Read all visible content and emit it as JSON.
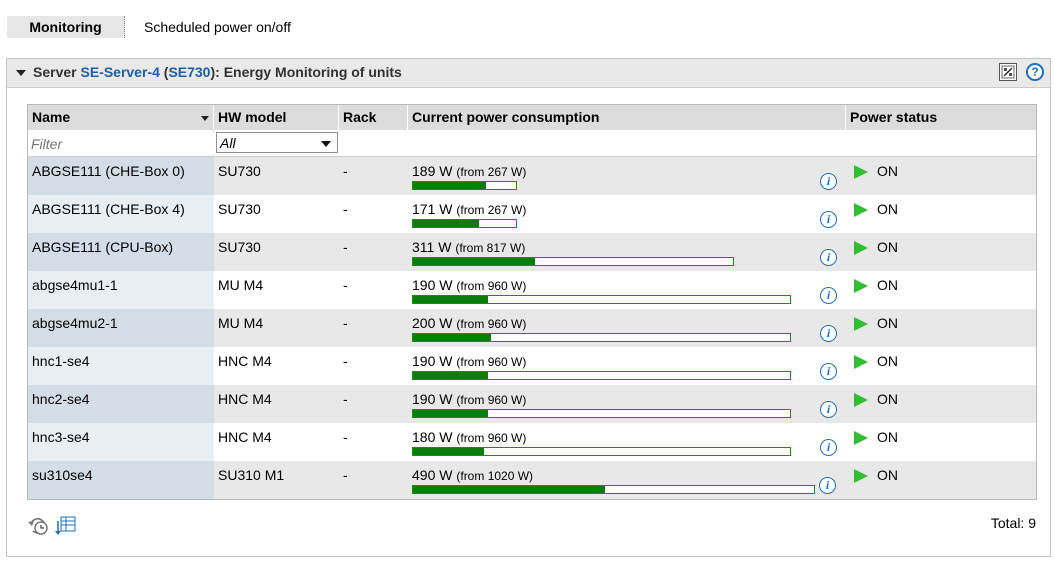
{
  "tabs": [
    {
      "label": "Monitoring",
      "active": true
    },
    {
      "label": "Scheduled power on/off",
      "active": false
    }
  ],
  "panel": {
    "prefix": "Server",
    "server_name": "SE-Server-4",
    "server_model": "SE730",
    "suffix": ": Energy Monitoring of units",
    "export_icon": "export-icon",
    "help_icon": "help-icon"
  },
  "table": {
    "columns": [
      "Name",
      "HW model",
      "Rack",
      "Current power consumption",
      "Power status"
    ],
    "filter": {
      "name_placeholder": "Filter",
      "hw_model_selected": "All"
    },
    "rows": [
      {
        "name": "ABGSE111 (CHE-Box 0)",
        "hw_model": "SU730",
        "rack": "-",
        "power": "189 W",
        "from": "(from 267 W)",
        "fraction": 0.708,
        "status": "ON"
      },
      {
        "name": "ABGSE111 (CHE-Box 4)",
        "hw_model": "SU730",
        "rack": "-",
        "power": "171 W",
        "from": "(from 267 W)",
        "fraction": 0.64,
        "status": "ON"
      },
      {
        "name": "ABGSE111 (CPU-Box)",
        "hw_model": "SU730",
        "rack": "-",
        "power": "311 W",
        "from": "(from 817 W)",
        "fraction": 0.381,
        "status": "ON"
      },
      {
        "name": "abgse4mu1-1",
        "hw_model": "MU M4",
        "rack": "-",
        "power": "190 W",
        "from": "(from 960 W)",
        "fraction": 0.198,
        "status": "ON"
      },
      {
        "name": "abgse4mu2-1",
        "hw_model": "MU M4",
        "rack": "-",
        "power": "200 W",
        "from": "(from 960 W)",
        "fraction": 0.208,
        "status": "ON"
      },
      {
        "name": "hnc1-se4",
        "hw_model": "HNC M4",
        "rack": "-",
        "power": "190 W",
        "from": "(from 960 W)",
        "fraction": 0.198,
        "status": "ON"
      },
      {
        "name": "hnc2-se4",
        "hw_model": "HNC M4",
        "rack": "-",
        "power": "190 W",
        "from": "(from 960 W)",
        "fraction": 0.198,
        "status": "ON"
      },
      {
        "name": "hnc3-se4",
        "hw_model": "HNC M4",
        "rack": "-",
        "power": "180 W",
        "from": "(from 960 W)",
        "fraction": 0.188,
        "status": "ON"
      },
      {
        "name": "su310se4",
        "hw_model": "SU310 M1",
        "rack": "-",
        "power": "490 W",
        "from": "(from 1020 W)",
        "fraction": 0.48,
        "status": "ON"
      }
    ]
  },
  "footer": {
    "refresh_icon": "refresh-history-icon",
    "table_icon": "table-export-icon",
    "total": "Total: 9"
  },
  "colors": {
    "bar_fill": "#0b7d0b",
    "status_on": "#2fbf2f",
    "link": "#1a5fa6"
  }
}
